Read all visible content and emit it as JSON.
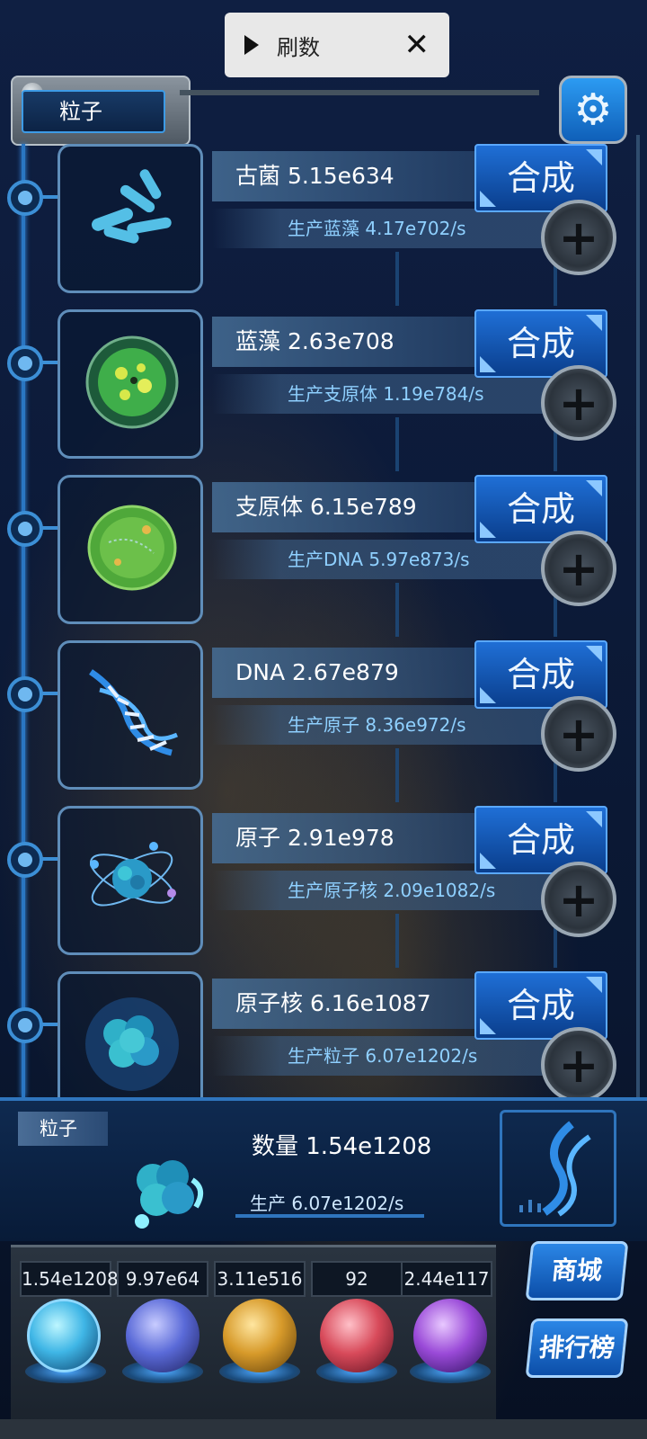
{
  "top_bar": {
    "label": "刷数"
  },
  "header": {
    "title": "粒子"
  },
  "rows": [
    {
      "name_value": "古菌 5.15e634",
      "production": "生产蓝藻 4.17e702/s",
      "synth_label": "合成",
      "icon": "archaea-icon"
    },
    {
      "name_value": "蓝藻 2.63e708",
      "production": "生产支原体 1.19e784/s",
      "synth_label": "合成",
      "icon": "cyanobacteria-icon"
    },
    {
      "name_value": "支原体 6.15e789",
      "production": "生产DNA 5.97e873/s",
      "synth_label": "合成",
      "icon": "mycoplasma-icon"
    },
    {
      "name_value": "DNA 2.67e879",
      "production": "生产原子 8.36e972/s",
      "synth_label": "合成",
      "icon": "dna-icon"
    },
    {
      "name_value": "原子 2.91e978",
      "production": "生产原子核 2.09e1082/s",
      "synth_label": "合成",
      "icon": "atom-icon"
    },
    {
      "name_value": "原子核 6.16e1087",
      "production": "生产粒子 6.07e1202/s",
      "synth_label": "合成",
      "icon": "nucleus-icon"
    }
  ],
  "bottom_panel": {
    "tag": "粒子",
    "quantity": "数量 1.54e1208",
    "production": "生产 6.07e1202/s"
  },
  "resources": [
    {
      "value": "1.54e1208",
      "color": "#3fb6e6",
      "icon": "particle-orb-icon"
    },
    {
      "value": "9.97e64",
      "color": "#5a6ad8",
      "icon": "lightning-orb-icon"
    },
    {
      "value": "3.11e516",
      "color": "#d79a2a",
      "icon": "galaxy-orb-icon"
    },
    {
      "value": "92",
      "color": "#d84a5a",
      "icon": "brain-orb-icon"
    },
    {
      "value": "2.44e117",
      "color": "#9a4ad8",
      "icon": "vortex-orb-icon"
    }
  ],
  "side_buttons": {
    "shop": "商城",
    "ranking": "排行榜"
  },
  "colors": {
    "accent": "#1f6fd6",
    "rail": "#2a76c2",
    "production_text": "#8fd0ff"
  }
}
